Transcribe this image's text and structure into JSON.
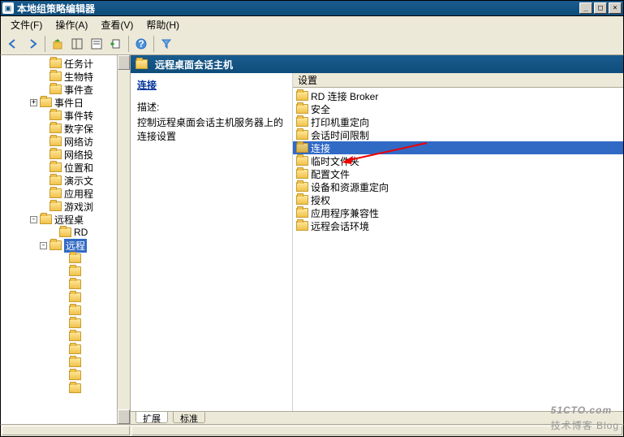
{
  "window": {
    "title": "本地组策略编辑器",
    "buttons": {
      "min": "_",
      "max": "□",
      "close": "×"
    }
  },
  "menu": [
    "文件(F)",
    "操作(A)",
    "查看(V)",
    "帮助(H)"
  ],
  "tree": {
    "items": [
      {
        "indent": 4,
        "toggle": "",
        "label": "任务计"
      },
      {
        "indent": 4,
        "toggle": "",
        "label": "生物特"
      },
      {
        "indent": 4,
        "toggle": "",
        "label": "事件查"
      },
      {
        "indent": 3,
        "toggle": "+",
        "label": "事件日"
      },
      {
        "indent": 4,
        "toggle": "",
        "label": "事件转"
      },
      {
        "indent": 4,
        "toggle": "",
        "label": "数字保"
      },
      {
        "indent": 4,
        "toggle": "",
        "label": "网络访"
      },
      {
        "indent": 4,
        "toggle": "",
        "label": "网络投"
      },
      {
        "indent": 4,
        "toggle": "",
        "label": "位置和"
      },
      {
        "indent": 4,
        "toggle": "",
        "label": "演示文"
      },
      {
        "indent": 4,
        "toggle": "",
        "label": "应用程"
      },
      {
        "indent": 4,
        "toggle": "",
        "label": "游戏浏"
      },
      {
        "indent": 3,
        "toggle": "-",
        "label": "远程桌"
      },
      {
        "indent": 5,
        "toggle": "",
        "label": "RD"
      },
      {
        "indent": 4,
        "toggle": "-",
        "label": "远程",
        "selected": true
      },
      {
        "indent": 6,
        "toggle": "",
        "label": ""
      },
      {
        "indent": 6,
        "toggle": "",
        "label": ""
      },
      {
        "indent": 6,
        "toggle": "",
        "label": ""
      },
      {
        "indent": 6,
        "toggle": "",
        "label": ""
      },
      {
        "indent": 6,
        "toggle": "",
        "label": ""
      },
      {
        "indent": 6,
        "toggle": "",
        "label": ""
      },
      {
        "indent": 6,
        "toggle": "",
        "label": ""
      },
      {
        "indent": 6,
        "toggle": "",
        "label": ""
      },
      {
        "indent": 6,
        "toggle": "",
        "label": ""
      },
      {
        "indent": 6,
        "toggle": "",
        "label": ""
      },
      {
        "indent": 6,
        "toggle": "",
        "label": ""
      }
    ]
  },
  "right": {
    "header": "远程桌面会话主机",
    "details": {
      "title": "连接",
      "desc_label": "描述:",
      "desc": "控制远程桌面会话主机服务器上的连接设置"
    },
    "list_header": "设置",
    "items": [
      {
        "label": "RD 连接 Broker"
      },
      {
        "label": "安全"
      },
      {
        "label": "打印机重定向"
      },
      {
        "label": "会话时间限制"
      },
      {
        "label": "连接",
        "selected": true
      },
      {
        "label": "临时文件夹"
      },
      {
        "label": "配置文件"
      },
      {
        "label": "设备和资源重定向"
      },
      {
        "label": "授权"
      },
      {
        "label": "应用程序兼容性"
      },
      {
        "label": "远程会话环境"
      }
    ]
  },
  "tabs": {
    "extended": "扩展",
    "standard": "标准"
  },
  "watermark": {
    "main": "51CTO.com",
    "sub": "技术博客  Blog"
  }
}
